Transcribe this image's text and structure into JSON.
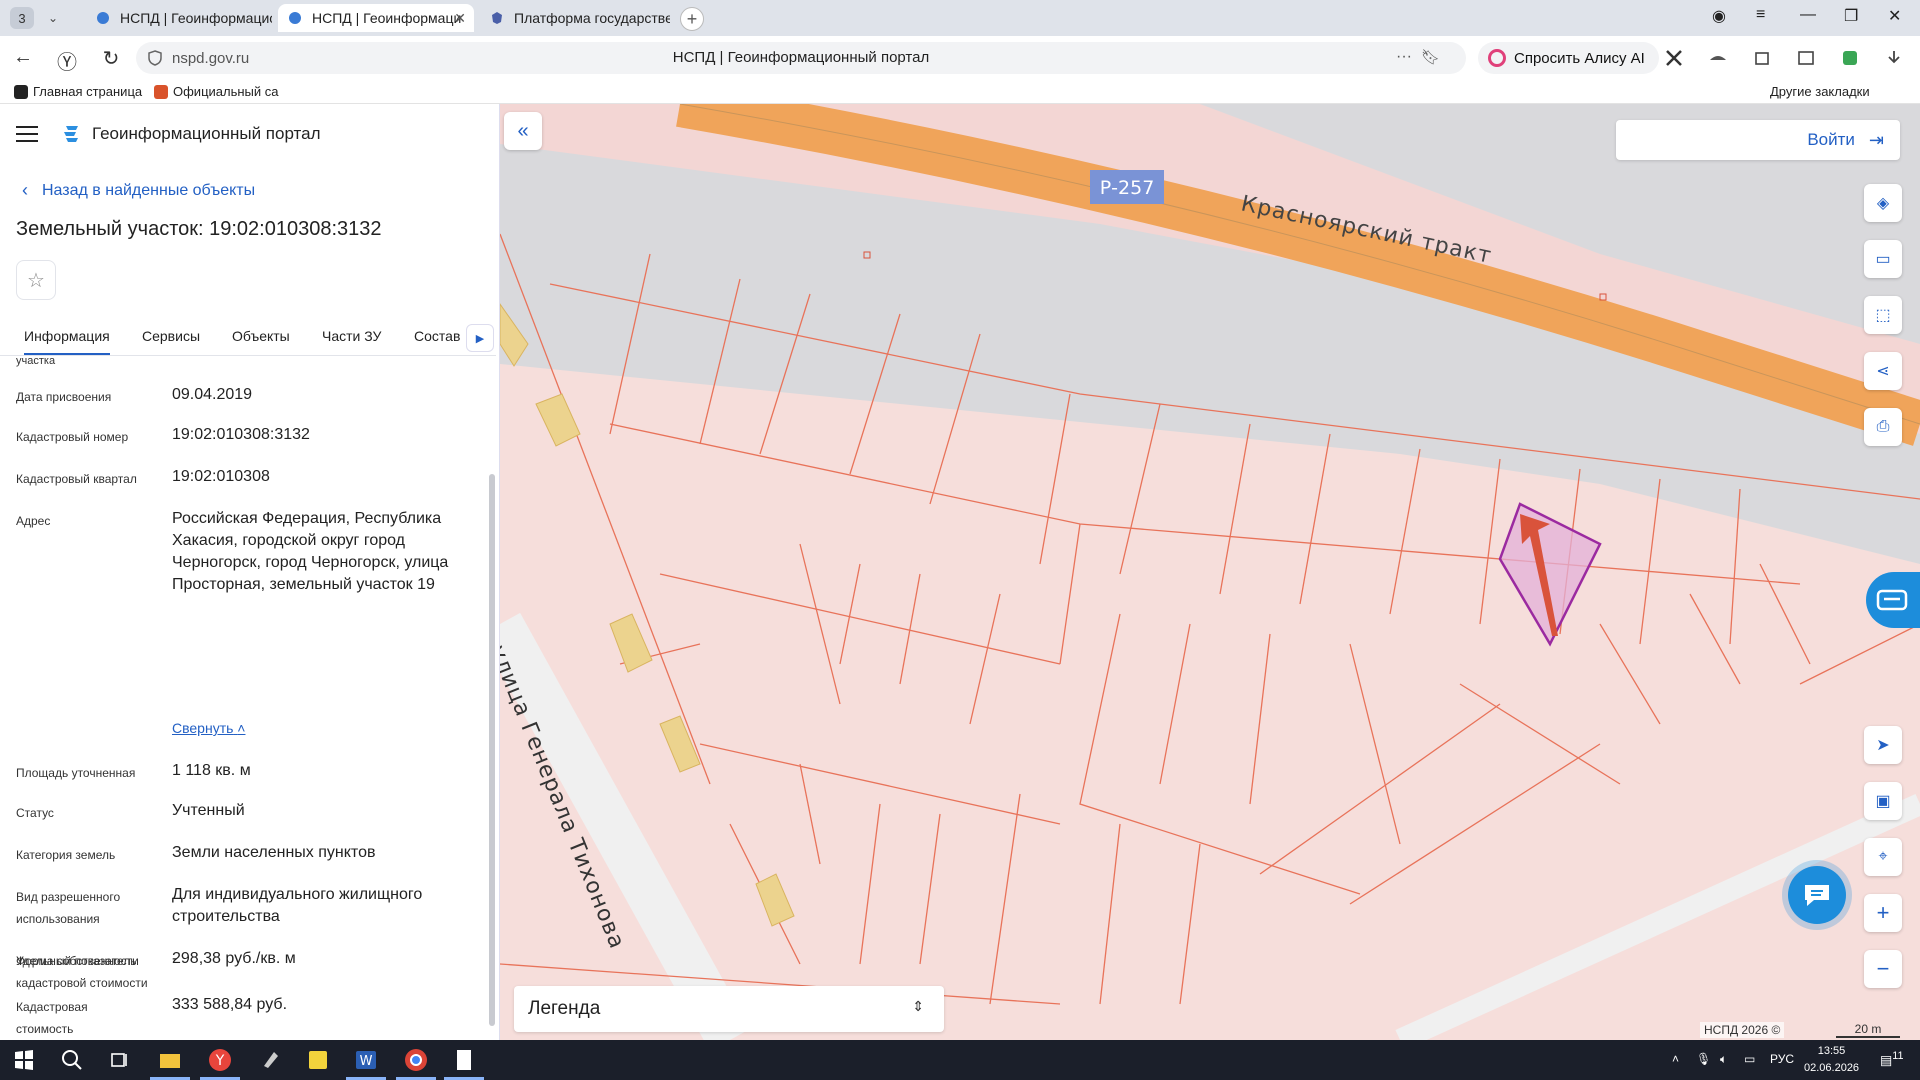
{
  "browser": {
    "tab_count": "3",
    "tabs": [
      {
        "label": "НСПД | Геоинформацион",
        "active": false
      },
      {
        "label": "НСПД | Геоинформаци",
        "active": true
      },
      {
        "label": "Платформа государстве",
        "active": false
      }
    ],
    "url_domain": "nspd.gov.ru",
    "page_title": "НСПД | Геоинформационный портал",
    "alice_label": "Спросить Алису AI",
    "bookmarks": [
      "Главная страница",
      "Официальный са"
    ],
    "other_bookmarks": "Другие закладки"
  },
  "sidebar": {
    "app_title": "Геоинформационный портал",
    "back_label": "Назад в найденные объекты",
    "object_title": "Земельный участок: 19:02:010308:3132",
    "tabs": [
      "Информация",
      "Сервисы",
      "Объекты",
      "Части ЗУ",
      "Состав"
    ],
    "cut_label": "участка",
    "properties": [
      {
        "label": "Дата присвоения",
        "value": "09.04.2019"
      },
      {
        "label": "Кадастровый номер",
        "value": "19:02:010308:3132"
      },
      {
        "label": "Кадастровый квартал",
        "value": "19:02:010308"
      },
      {
        "label": "Адрес",
        "value": "Российская Федерация, Республика Хакасия, городской округ город Черногорск, город Черногорск, улица Просторная, земельный участок 19"
      },
      {
        "label": "Площадь уточненная",
        "value": "1 118 кв. м"
      },
      {
        "label": "Статус",
        "value": "Учтенный"
      },
      {
        "label": "Категория земель",
        "value": "Земли населенных пунктов"
      },
      {
        "label": "Вид разрешенного использования",
        "value": "Для индивидуального жилищного строительства"
      },
      {
        "label": "Форма собственности",
        "value": "-"
      },
      {
        "label": "Кадастровая стоимость",
        "value": "333 588,84 руб."
      },
      {
        "label": "Удельный показатель кадастровой стоимости",
        "value": "298,38 руб./кв. м"
      }
    ],
    "collapse_label": "Свернуть"
  },
  "map": {
    "login_label": "Войти",
    "road_shield": "Р-257",
    "road_name": "Красноярский тракт",
    "street_name": "улица Генерала Тихонова",
    "legend_label": "Легенда",
    "copyright": "НСПД 2026 ©",
    "scale_label": "20 m",
    "colors": {
      "accent": "#2360c4",
      "parcel_line": "#e8735a",
      "selected": "#9b2aa0",
      "road": "#f0a45a"
    }
  },
  "taskbar": {
    "lang": "РУС",
    "time": "13:55",
    "date": "02.06.2026",
    "notif_count": "11"
  }
}
